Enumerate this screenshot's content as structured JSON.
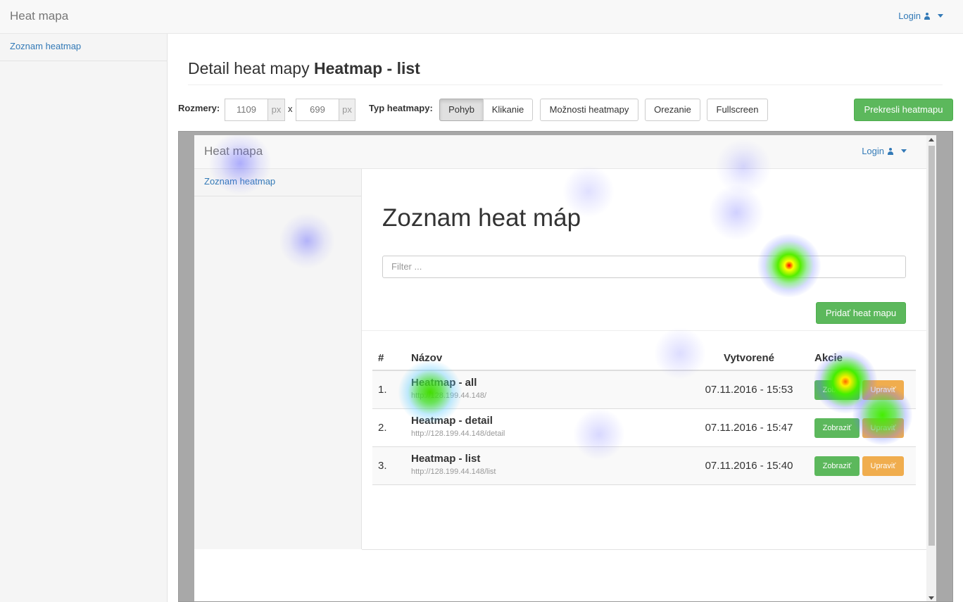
{
  "app": {
    "brand": "Heat mapa",
    "login": "Login"
  },
  "sidebar": {
    "items": [
      {
        "label": "Zoznam heatmap"
      }
    ]
  },
  "page": {
    "title_prefix": "Detail heat mapy",
    "title_name": "Heatmap - list"
  },
  "toolbar": {
    "dims_label": "Rozmery:",
    "width_value": "1109",
    "width_unit": "px",
    "times": "x",
    "height_value": "699",
    "height_unit": "px",
    "type_label": "Typ heatmapy:",
    "type_options": [
      "Pohyb",
      "Klikanie"
    ],
    "type_selected": "Pohyb",
    "options_button": "Možnosti heatmapy",
    "crop_button": "Orezanie",
    "fullscreen_button": "Fullscreen",
    "redraw_button": "Prekresli heatmapu"
  },
  "preview": {
    "brand": "Heat mapa",
    "login": "Login",
    "sidebar_item": "Zoznam heatmap",
    "title": "Zoznam heat máp",
    "filter_placeholder": "Filter ...",
    "add_button": "Pridať heat mapu",
    "table": {
      "headers": [
        "#",
        "Názov",
        "Vytvorené",
        "Akcie"
      ],
      "rows": [
        {
          "num": "1.",
          "name": "Heatmap - all",
          "url": "http://128.199.44.148/",
          "date": "07.11.2016 - 15:53",
          "view": "Zobraziť",
          "edit": "Upraviť"
        },
        {
          "num": "2.",
          "name": "Heatmap - detail",
          "url": "http://128.199.44.148/detail",
          "date": "07.11.2016 - 15:47",
          "view": "Zobraziť",
          "edit": "Upraviť"
        },
        {
          "num": "3.",
          "name": "Heatmap - list",
          "url": "http://128.199.44.148/list",
          "date": "07.11.2016 - 15:40",
          "view": "Zobraziť",
          "edit": "Upraviť"
        }
      ]
    }
  },
  "colors": {
    "link": "#337ab7",
    "success": "#5cb85c",
    "warning": "#f0ad4e",
    "frame": "#a8a8a8"
  }
}
